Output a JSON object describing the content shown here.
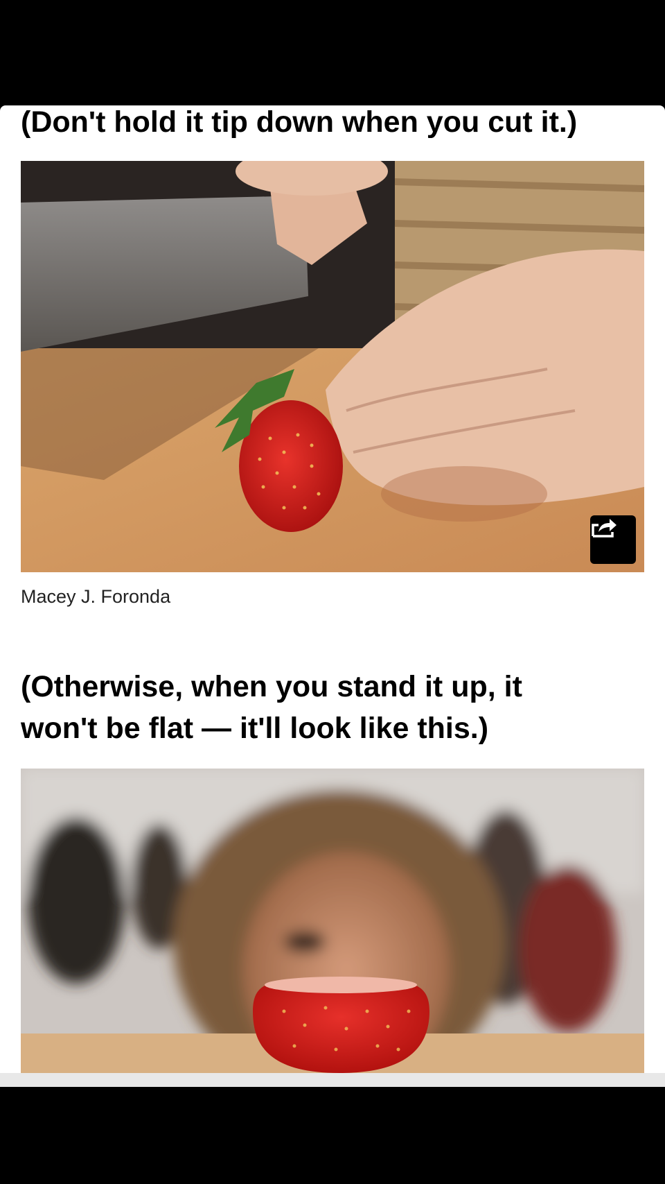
{
  "article": {
    "heading_1": "(Don't hold it tip down when you cut it.)",
    "photo_1_caption": "Macey J. Foronda",
    "heading_2_line_1": "(Otherwise, when you stand it up, it",
    "heading_2_line_2": "won't be flat — it'll look like this.)"
  },
  "icons": {
    "share": "share-arrow-icon"
  },
  "colors": {
    "page_background": "#ffffff",
    "frame_background": "#000000",
    "share_button": "#000000",
    "strawberry": "#d21e1e"
  }
}
